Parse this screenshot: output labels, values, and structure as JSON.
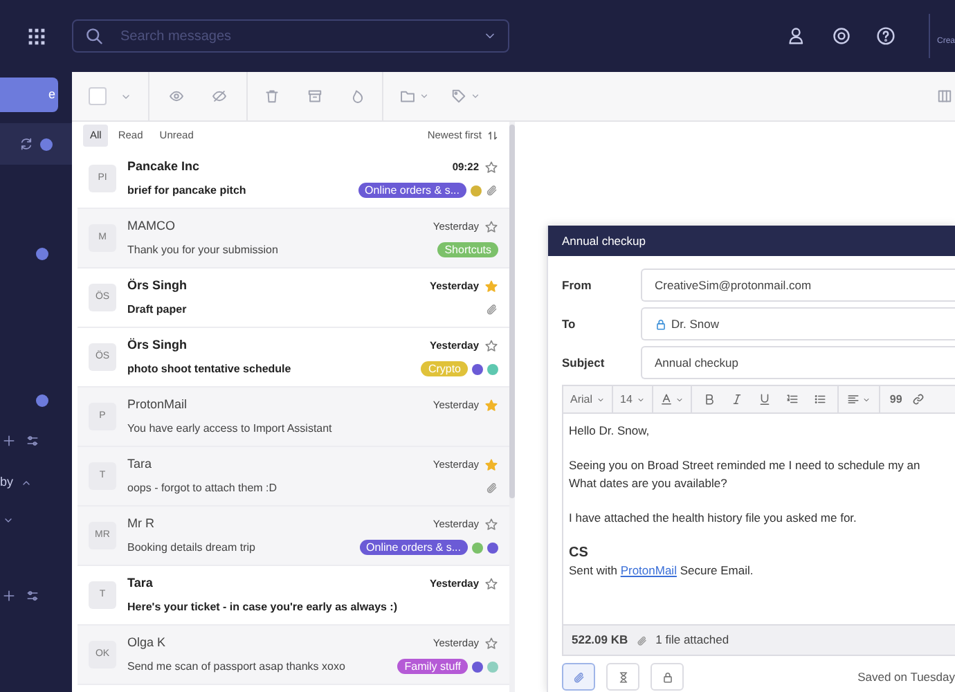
{
  "topbar": {
    "search": {
      "placeholder": "Search messages"
    },
    "account": "Crea"
  },
  "sidebar": {
    "compose": "e",
    "section_label": "by"
  },
  "toolbar": {
    "select_all": {
      "checked": false
    }
  },
  "filters": {
    "tabs": [
      {
        "label": "All",
        "selected": true
      },
      {
        "label": "Read",
        "selected": false
      },
      {
        "label": "Unread",
        "selected": false
      }
    ],
    "sort": "Newest first"
  },
  "messages": [
    {
      "initials": "PI",
      "sender": "Pancake Inc",
      "subject": "brief for pancake pitch",
      "time": "09:22",
      "unread": true,
      "starred": false,
      "attachment": true,
      "labels": [
        {
          "text": "Online orders & s...",
          "color": "#6b5bd6"
        }
      ],
      "dots": [
        {
          "color": "#d4b43a"
        }
      ]
    },
    {
      "initials": "M",
      "sender": "MAMCO",
      "subject": "Thank you for your submission",
      "time": "Yesterday",
      "unread": false,
      "starred": false,
      "attachment": false,
      "labels": [
        {
          "text": "Shortcuts",
          "color": "#7cc16a"
        }
      ]
    },
    {
      "initials": "ÖS",
      "sender": "Örs Singh",
      "subject": "Draft paper",
      "time": "Yesterday",
      "unread": true,
      "starred": true,
      "attachment": true
    },
    {
      "initials": "ÖS",
      "sender": "Örs Singh",
      "subject": "photo shoot tentative schedule",
      "time": "Yesterday",
      "unread": true,
      "starred": false,
      "attachment": false,
      "labels": [
        {
          "text": "Crypto",
          "color": "#e0c23a"
        }
      ],
      "dots": [
        {
          "color": "#6b5bd6"
        },
        {
          "color": "#5ec8b0"
        }
      ]
    },
    {
      "initials": "P",
      "sender": "ProtonMail",
      "subject": "You have early access to Import Assistant",
      "time": "Yesterday",
      "unread": false,
      "starred": true,
      "attachment": false
    },
    {
      "initials": "T",
      "sender": "Tara",
      "subject": "oops - forgot to attach them :D",
      "time": "Yesterday",
      "unread": false,
      "starred": true,
      "attachment": true
    },
    {
      "initials": "MR",
      "sender": "Mr R",
      "subject": "Booking details dream trip",
      "time": "Yesterday",
      "unread": false,
      "starred": false,
      "attachment": false,
      "labels": [
        {
          "text": "Online orders & s...",
          "color": "#6b5bd6"
        }
      ],
      "dots": [
        {
          "color": "#7cc16a"
        },
        {
          "color": "#6b5bd6"
        }
      ]
    },
    {
      "initials": "T",
      "sender": "Tara",
      "subject": "Here's your ticket - in case you're early as always :)",
      "time": "Yesterday",
      "unread": true,
      "starred": false,
      "attachment": false
    },
    {
      "initials": "OK",
      "sender": "Olga K",
      "subject": "Send me scan of passport asap thanks xoxo",
      "time": "Yesterday",
      "unread": false,
      "starred": false,
      "attachment": false,
      "labels": [
        {
          "text": "Family stuff",
          "color": "#b55ad6"
        }
      ],
      "dots": [
        {
          "color": "#6b5bd6"
        },
        {
          "color": "#8fd0c0"
        }
      ]
    }
  ],
  "composer": {
    "title": "Annual checkup",
    "fields": [
      {
        "label": "From",
        "value": "CreativeSim@protonmail.com",
        "locked": false
      },
      {
        "label": "To",
        "value": "Dr. Snow",
        "locked": true
      },
      {
        "label": "Subject",
        "value": "Annual checkup",
        "locked": false
      }
    ],
    "toolbar": {
      "font": "Arial",
      "size": "14",
      "quote": "99"
    },
    "body": [
      [
        "Hello Dr. Snow,"
      ],
      [
        "Seeing you on Broad Street reminded me I need to schedule my an",
        "What dates are you available?"
      ],
      [
        "I have attached the health history file you asked me for."
      ]
    ],
    "signature": {
      "name": "CS",
      "prefix": "Sent with",
      "link": "ProtonMail",
      "suffix": "Secure Email."
    },
    "size": "522.09 KB",
    "attachments": "1 file attached",
    "saved": "Saved on Tuesday"
  }
}
